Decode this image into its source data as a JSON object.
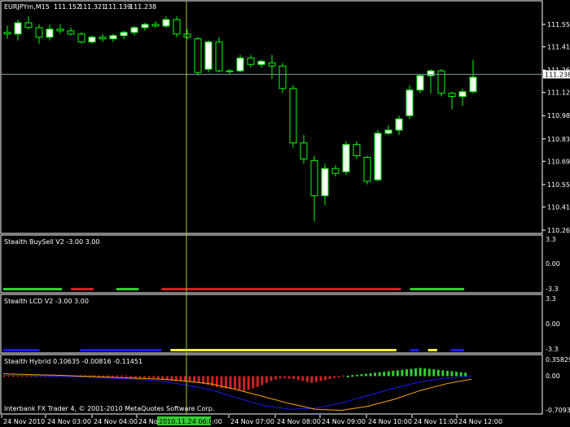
{
  "window": {
    "symbol_header": "EURJPYm,M15",
    "ohlc": [
      "111.152",
      "111.321",
      "111.139",
      "111.238"
    ],
    "current_price": "111.238",
    "cursor_time_label": "2010.11.24 06:00",
    "copyright": "Interbank FX Trader 4, © 2001-2010 MetaQuotes Software Corp."
  },
  "colors": {
    "background": "#000000",
    "bull_candle": "#ffffff",
    "bear_candle": "#000000",
    "candle_outline": "#00ff00",
    "crosshair": "#9acd32",
    "price_line": "#7f9aa6",
    "indicator_green": "#32cd32",
    "indicator_red": "#cc2222",
    "indicator_blue": "#1a1aff",
    "indicator_yellow": "#ffff33",
    "hybrid_orange": "#ffa500",
    "time_highlight": "#32cd32"
  },
  "price_axis": {
    "ticks": [
      "111.550",
      "111.410",
      "111.265",
      "111.125",
      "110.980",
      "110.835",
      "110.695",
      "110.550",
      "110.410",
      "110.265"
    ]
  },
  "panels": {
    "buysell": {
      "title": "Stealth BuySell V2 -3.00 3.00",
      "ticks": [
        "3.3",
        "0.00",
        "-3.3"
      ],
      "segments": [
        {
          "start": 0,
          "end": 13,
          "color": "green"
        },
        {
          "start": 15,
          "end": 20,
          "color": "red"
        },
        {
          "start": 25,
          "end": 30,
          "color": "green"
        },
        {
          "start": 35,
          "end": 88,
          "color": "red"
        },
        {
          "start": 90,
          "end": 102,
          "color": "green"
        }
      ]
    },
    "lcd": {
      "title": "Stealth LCD V2 -3.00 3.00",
      "ticks": [
        "3.3",
        "0.00",
        "-3.3"
      ],
      "segments": [
        {
          "start": 0,
          "end": 8,
          "color": "blue"
        },
        {
          "start": 17,
          "end": 35,
          "color": "blue"
        },
        {
          "start": 37,
          "end": 87,
          "color": "yellow"
        },
        {
          "start": 90,
          "end": 92,
          "color": "blue"
        },
        {
          "start": 94,
          "end": 96,
          "color": "yellow"
        },
        {
          "start": 99,
          "end": 102,
          "color": "blue"
        }
      ]
    },
    "hybrid": {
      "title": "Stealth Hybrid 0.10635 -0.00816 -0.11451",
      "ticks": [
        "0.35829",
        "0.00",
        "-0.70933"
      ],
      "histogram": [
        0,
        0,
        0,
        0,
        0,
        0,
        0,
        0,
        0,
        0,
        0,
        0,
        0,
        0,
        0,
        0,
        0,
        0,
        0,
        0,
        0,
        0,
        0,
        0,
        0,
        0,
        0,
        0,
        -0.005,
        -0.01,
        -0.015,
        -0.02,
        -0.03,
        -0.04,
        -0.05,
        -0.06,
        -0.07,
        -0.08,
        -0.09,
        -0.1,
        -0.11,
        -0.12,
        -0.13,
        -0.14,
        -0.16,
        -0.18,
        -0.2,
        -0.22,
        -0.24,
        -0.25,
        -0.26,
        -0.27,
        -0.28,
        -0.3,
        -0.28,
        -0.25,
        -0.22,
        -0.18,
        -0.14,
        -0.1,
        -0.07,
        -0.05,
        -0.04,
        -0.05,
        -0.06,
        -0.08,
        -0.1,
        -0.12,
        -0.14,
        -0.12,
        -0.1,
        -0.08,
        -0.06,
        -0.04,
        -0.02,
        0,
        0.01,
        0.02,
        0.03,
        0.04,
        0.05,
        0.06,
        0.07,
        0.08,
        0.09,
        0.1,
        0.11,
        0.12,
        0.13,
        0.14,
        0.15,
        0.16,
        0.17,
        0.16,
        0.15,
        0.14,
        0.13,
        0.12,
        0.11,
        0.1,
        0.09,
        0.08,
        0.07
      ],
      "blue_line": [
        0.02,
        0.01,
        0.0,
        -0.02,
        -0.04,
        -0.06,
        -0.1,
        -0.18,
        -0.28,
        -0.45,
        -0.6,
        -0.68,
        -0.66,
        -0.55,
        -0.4,
        -0.25,
        -0.12,
        -0.04,
        0.0
      ],
      "orange_line": [
        0.05,
        0.03,
        0.02,
        0.0,
        -0.02,
        -0.04,
        -0.06,
        -0.1,
        -0.16,
        -0.28,
        -0.42,
        -0.56,
        -0.68,
        -0.7,
        -0.62,
        -0.48,
        -0.3,
        -0.16,
        -0.06
      ]
    }
  },
  "time_axis": {
    "labels": [
      "24 Nov 2010",
      "24 Nov 03:00",
      "24 Nov 04:00",
      "24 Nov 0",
      "",
      "24 Nov 07:00",
      "24 Nov 08:00",
      "24 Nov 09:00",
      "24 Nov 10:00",
      "24 Nov 11:00",
      "24 Nov 12:00"
    ],
    "cursor_suffix": ":00"
  },
  "candles": [
    {
      "o": 111.5,
      "h": 111.54,
      "l": 111.46,
      "c": 111.49
    },
    {
      "o": 111.49,
      "h": 111.58,
      "l": 111.45,
      "c": 111.56
    },
    {
      "o": 111.56,
      "h": 111.6,
      "l": 111.52,
      "c": 111.53
    },
    {
      "o": 111.53,
      "h": 111.55,
      "l": 111.43,
      "c": 111.47
    },
    {
      "o": 111.47,
      "h": 111.55,
      "l": 111.45,
      "c": 111.52
    },
    {
      "o": 111.52,
      "h": 111.55,
      "l": 111.49,
      "c": 111.51
    },
    {
      "o": 111.51,
      "h": 111.53,
      "l": 111.48,
      "c": 111.49
    },
    {
      "o": 111.49,
      "h": 111.5,
      "l": 111.43,
      "c": 111.44
    },
    {
      "o": 111.44,
      "h": 111.48,
      "l": 111.43,
      "c": 111.47
    },
    {
      "o": 111.47,
      "h": 111.49,
      "l": 111.44,
      "c": 111.46
    },
    {
      "o": 111.46,
      "h": 111.49,
      "l": 111.44,
      "c": 111.48
    },
    {
      "o": 111.48,
      "h": 111.51,
      "l": 111.46,
      "c": 111.5
    },
    {
      "o": 111.5,
      "h": 111.54,
      "l": 111.48,
      "c": 111.53
    },
    {
      "o": 111.53,
      "h": 111.56,
      "l": 111.51,
      "c": 111.55
    },
    {
      "o": 111.55,
      "h": 111.57,
      "l": 111.53,
      "c": 111.54
    },
    {
      "o": 111.54,
      "h": 111.6,
      "l": 111.53,
      "c": 111.58
    },
    {
      "o": 111.58,
      "h": 111.6,
      "l": 111.47,
      "c": 111.49
    },
    {
      "o": 111.49,
      "h": 111.52,
      "l": 111.46,
      "c": 111.47
    },
    {
      "o": 111.46,
      "h": 111.47,
      "l": 111.23,
      "c": 111.25
    },
    {
      "o": 111.27,
      "h": 111.45,
      "l": 111.25,
      "c": 111.44
    },
    {
      "o": 111.44,
      "h": 111.47,
      "l": 111.25,
      "c": 111.26
    },
    {
      "o": 111.26,
      "h": 111.27,
      "l": 111.24,
      "c": 111.26
    },
    {
      "o": 111.26,
      "h": 111.36,
      "l": 111.25,
      "c": 111.34
    },
    {
      "o": 111.34,
      "h": 111.36,
      "l": 111.28,
      "c": 111.3
    },
    {
      "o": 111.3,
      "h": 111.33,
      "l": 111.28,
      "c": 111.32
    },
    {
      "o": 111.31,
      "h": 111.36,
      "l": 111.21,
      "c": 111.29
    },
    {
      "o": 111.29,
      "h": 111.31,
      "l": 111.12,
      "c": 111.15
    },
    {
      "o": 111.15,
      "h": 111.17,
      "l": 110.78,
      "c": 110.81
    },
    {
      "o": 110.81,
      "h": 110.86,
      "l": 110.68,
      "c": 110.71
    },
    {
      "o": 110.7,
      "h": 110.73,
      "l": 110.32,
      "c": 110.48
    },
    {
      "o": 110.48,
      "h": 110.68,
      "l": 110.42,
      "c": 110.65
    },
    {
      "o": 110.65,
      "h": 110.67,
      "l": 110.6,
      "c": 110.62
    },
    {
      "o": 110.63,
      "h": 110.82,
      "l": 110.61,
      "c": 110.8
    },
    {
      "o": 110.8,
      "h": 110.82,
      "l": 110.71,
      "c": 110.73
    },
    {
      "o": 110.72,
      "h": 110.73,
      "l": 110.55,
      "c": 110.57
    },
    {
      "o": 110.58,
      "h": 110.89,
      "l": 110.57,
      "c": 110.87
    },
    {
      "o": 110.87,
      "h": 110.92,
      "l": 110.86,
      "c": 110.89
    },
    {
      "o": 110.89,
      "h": 110.98,
      "l": 110.86,
      "c": 110.96
    },
    {
      "o": 110.98,
      "h": 111.17,
      "l": 110.96,
      "c": 111.14
    },
    {
      "o": 111.14,
      "h": 111.24,
      "l": 111.12,
      "c": 111.23
    },
    {
      "o": 111.23,
      "h": 111.27,
      "l": 111.12,
      "c": 111.26
    },
    {
      "o": 111.26,
      "h": 111.27,
      "l": 111.1,
      "c": 111.12
    },
    {
      "o": 111.12,
      "h": 111.13,
      "l": 111.02,
      "c": 111.1
    },
    {
      "o": 111.1,
      "h": 111.15,
      "l": 111.04,
      "c": 111.13
    },
    {
      "o": 111.13,
      "h": 111.33,
      "l": 111.12,
      "c": 111.22
    }
  ]
}
